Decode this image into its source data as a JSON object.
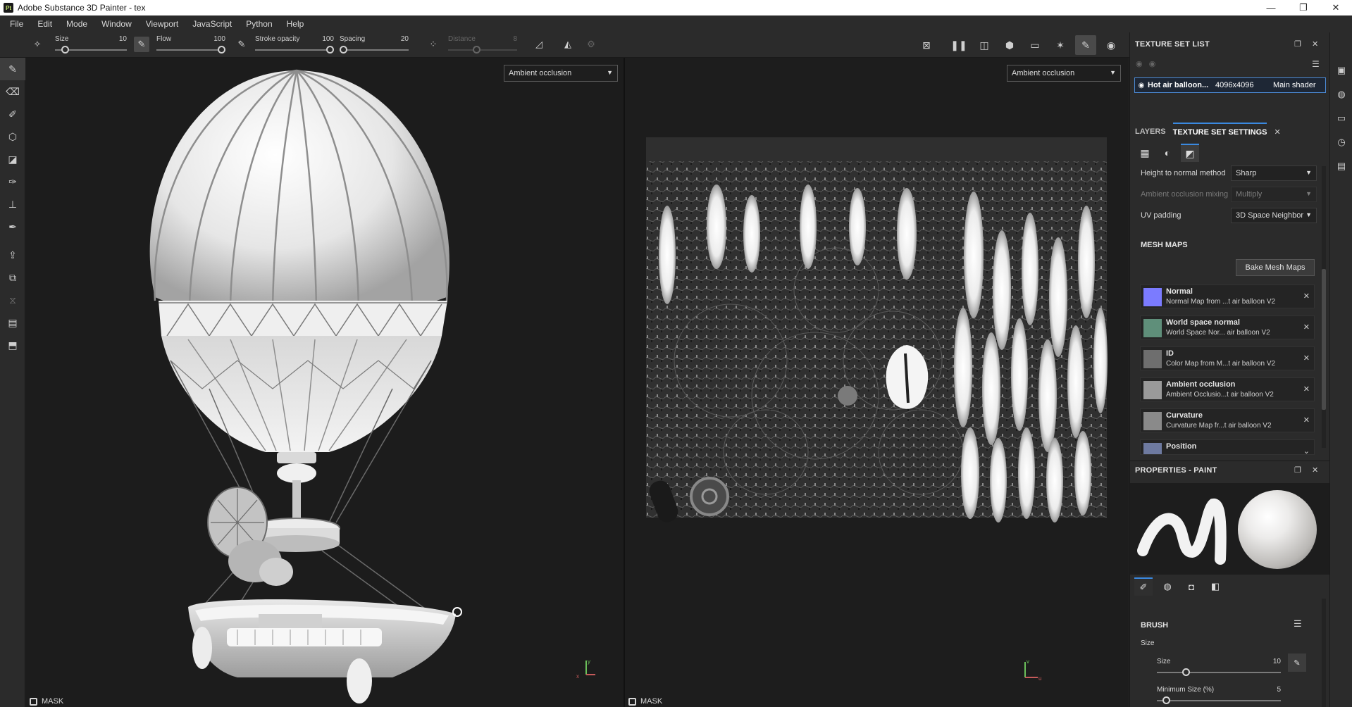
{
  "window": {
    "app_icon": "Pt",
    "title": "Adobe Substance 3D Painter - tex",
    "controls": [
      "—",
      "❐",
      "✕"
    ]
  },
  "menu": [
    "File",
    "Edit",
    "Mode",
    "Window",
    "Viewport",
    "JavaScript",
    "Python",
    "Help"
  ],
  "tool_options": {
    "size": {
      "label": "Size",
      "value": "10",
      "fraction": 0.1
    },
    "flow": {
      "label": "Flow",
      "value": "100",
      "fraction": 1.0
    },
    "stroke_opacity": {
      "label": "Stroke opacity",
      "value": "100",
      "fraction": 1.0
    },
    "spacing": {
      "label": "Spacing",
      "value": "20",
      "fraction": 0.0
    },
    "distance": {
      "label": "Distance",
      "value": "8",
      "fraction": 0.4
    }
  },
  "viewport_3d": {
    "channel": "Ambient occlusion",
    "mask_label": "MASK"
  },
  "viewport_2d": {
    "channel": "Ambient occlusion",
    "mask_label": "MASK"
  },
  "axis_labels": {
    "x": "x",
    "y": "y",
    "u": "u",
    "v": "v"
  },
  "texture_set_list": {
    "title": "TEXTURE SET LIST",
    "row": {
      "name": "Hot air balloon...",
      "resolution": "4096x4096",
      "shader": "Main shader"
    }
  },
  "tabs": {
    "layers": "LAYERS",
    "texture_set_settings": "TEXTURE SET SETTINGS"
  },
  "settings": {
    "height_to_normal": {
      "label": "Height to normal method",
      "value": "Sharp"
    },
    "ao_mixing": {
      "label": "Ambient occlusion mixing",
      "value": "Multiply"
    },
    "uv_padding": {
      "label": "UV padding",
      "value": "3D Space Neighbor"
    }
  },
  "mesh_maps": {
    "title": "MESH MAPS",
    "bake_label": "Bake Mesh Maps",
    "items": [
      {
        "name": "Normal",
        "file": "Normal Map from ...t air balloon V2",
        "color": "#7b7bff"
      },
      {
        "name": "World space normal",
        "file": "World Space Nor... air balloon V2",
        "color": "#5f8f7a"
      },
      {
        "name": "ID",
        "file": "Color Map from M...t air balloon V2",
        "color": "#6e6e6e"
      },
      {
        "name": "Ambient occlusion",
        "file": "Ambient Occlusio...t air balloon V2",
        "color": "#9a9a9a"
      },
      {
        "name": "Curvature",
        "file": "Curvature Map fr...t air balloon V2",
        "color": "#8a8a8a"
      },
      {
        "name": "Position",
        "file": "",
        "color": "#6e7aa0"
      }
    ]
  },
  "properties": {
    "title": "PROPERTIES - PAINT",
    "brush_title": "BRUSH",
    "size_group": "Size",
    "size": {
      "label": "Size",
      "value": "10",
      "fraction": 0.22
    },
    "min_size": {
      "label": "Minimum Size (%)",
      "value": "5",
      "fraction": 0.05
    }
  },
  "colors": {
    "accent": "#3a89e0",
    "panel": "#2b2b2b",
    "viewport": "#1c1c1c"
  }
}
